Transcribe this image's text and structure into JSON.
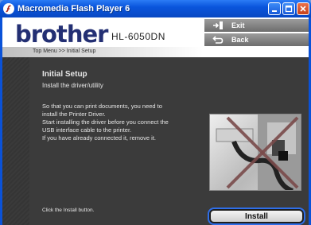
{
  "window": {
    "title": "Macromedia Flash Player 6",
    "icon": "flash-player-icon"
  },
  "header": {
    "logo": "brother",
    "model": "HL-6050DN",
    "breadcrumb": "Top Menu >> Initial Setup",
    "exit_label": "Exit",
    "back_label": "Back"
  },
  "main": {
    "title": "Initial Setup",
    "subtitle": "Install the driver/utility",
    "body_lines": [
      "So that you can print documents, you need to",
      "install the Printer Driver.",
      "Start installing the driver before you connect the",
      "USB interface cable to the printer.",
      "If you have already connected it, remove it."
    ],
    "hint": "Click the Install button.",
    "install_label": "Install"
  },
  "colors": {
    "titlebar": "#0a55dc",
    "logo": "#232f73",
    "panel": "#3b3b3b",
    "install_highlight": "#2f6ee8"
  }
}
